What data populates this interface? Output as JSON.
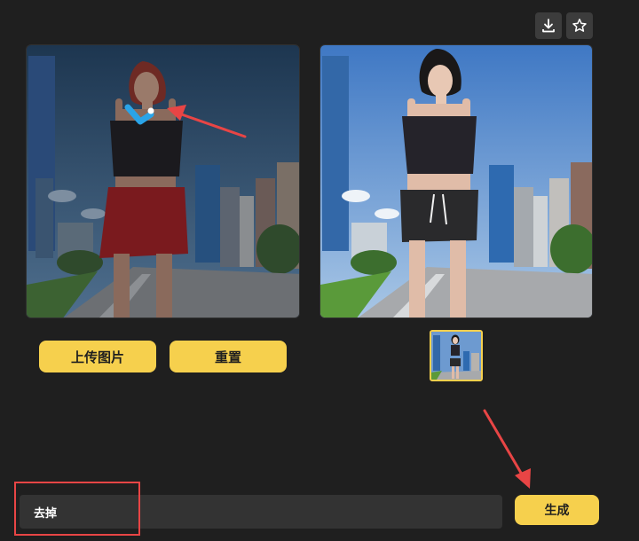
{
  "toolbar": {
    "download_icon": "download-icon",
    "favorite_icon": "star-icon"
  },
  "buttons": {
    "upload_label": "上传图片",
    "reset_label": "重置",
    "generate_label": "生成"
  },
  "prompt": {
    "value": "去掉"
  },
  "colors": {
    "background": "#1f1f1f",
    "accent_yellow": "#f6d04d",
    "annotation_red": "#e84545",
    "mask_blue": "#2aa4e8",
    "input_bg": "#333333"
  }
}
